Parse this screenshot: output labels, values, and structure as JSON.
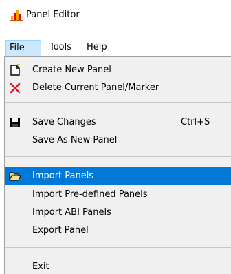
{
  "window": {
    "title": "Panel Editor",
    "icon": "panel-editor-app-icon"
  },
  "menubar": {
    "items": [
      {
        "label": "File",
        "active": true
      },
      {
        "label": "Tools",
        "active": false
      },
      {
        "label": "Help",
        "active": false
      }
    ]
  },
  "file_menu": {
    "items": [
      {
        "label": "Create New Panel",
        "icon": "new-document-icon"
      },
      {
        "label": "Delete Current Panel/Marker",
        "icon": "delete-x-icon"
      },
      {
        "label": "Save Changes",
        "shortcut": "Ctrl+S",
        "icon": "save-floppy-icon"
      },
      {
        "label": "Save As New Panel"
      },
      {
        "label": "Import Panels",
        "icon": "open-folder-icon",
        "highlighted": true
      },
      {
        "label": "Import Pre-defined Panels"
      },
      {
        "label": "Import ABI Panels"
      },
      {
        "label": "Export Panel"
      },
      {
        "label": "Exit"
      }
    ]
  },
  "colors": {
    "highlight": "#0078d7",
    "menubar_active": "#cce8ff",
    "menu_background": "#f0f0f0",
    "delete_icon": "#e81123"
  }
}
